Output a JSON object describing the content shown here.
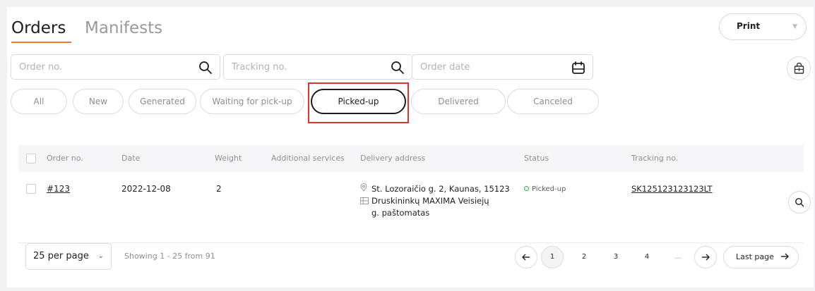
{
  "tabs": {
    "orders": "Orders",
    "manifests": "Manifests"
  },
  "print": {
    "label": "Print"
  },
  "filters": {
    "order_no_placeholder": "Order no.",
    "tracking_placeholder": "Tracking no.",
    "date_placeholder": "Order date"
  },
  "status_filters": [
    "All",
    "New",
    "Generated",
    "Waiting for pick-up",
    "Picked-up",
    "Delivered",
    "Canceled"
  ],
  "active_filter": "Picked-up",
  "table": {
    "headers": {
      "order_no": "Order no.",
      "date": "Date",
      "weight": "Weight",
      "additional": "Additional services",
      "address": "Delivery address",
      "status": "Status",
      "tracking": "Tracking no."
    },
    "rows": [
      {
        "order_no": "#123",
        "date": "2022-12-08",
        "weight": "2",
        "address_line": "St. Lozoraičio g. 2, Kaunas, 15123",
        "locker_line1": "Druskininkų MAXIMA Veisiejų",
        "locker_line2": "g. paštomatas",
        "status": "Picked-up",
        "tracking": "SK125123123123LT"
      }
    ]
  },
  "footer": {
    "per_page": "25 per page",
    "showing": "Showing 1 - 25 from 91",
    "pages": [
      "1",
      "2",
      "3",
      "4",
      "..."
    ],
    "current_page": "1",
    "last_page": "Last page"
  },
  "colors": {
    "accent": "#f07c2a",
    "status_green": "#38b24a",
    "highlight": "#e0312b"
  },
  "icons": [
    "search-icon",
    "calendar-icon",
    "shopping-bag-icon",
    "chevron-down-icon",
    "arrow-left-icon",
    "arrow-right-icon",
    "location-pin-icon",
    "locker-icon"
  ]
}
